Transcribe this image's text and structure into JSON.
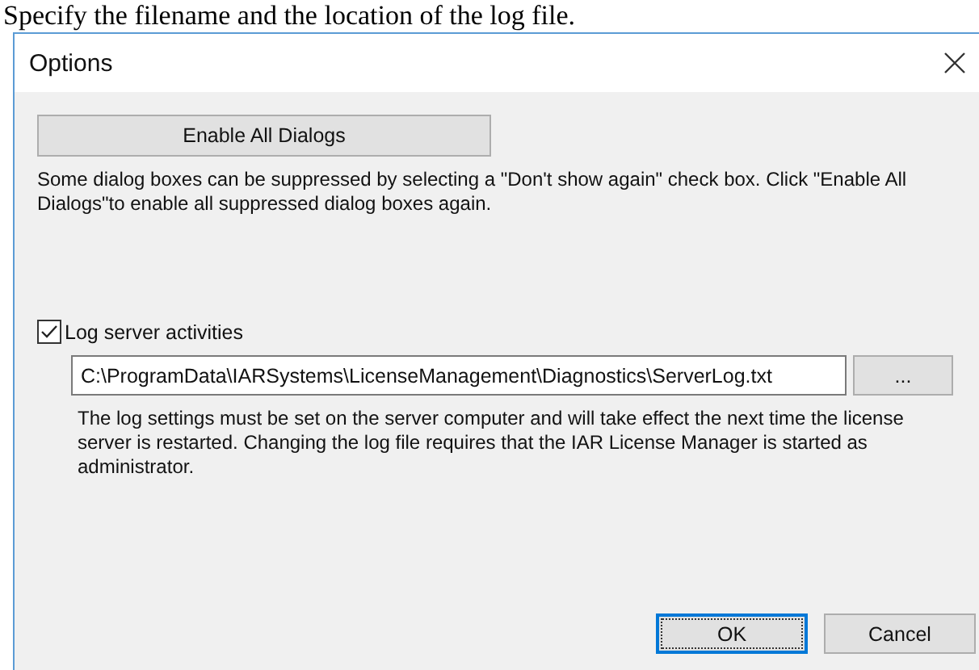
{
  "document_text": "Specify the filename and the location of the log file.",
  "window": {
    "title": "Options"
  },
  "enable_button": "Enable All Dialogs",
  "enable_description": "Some dialog boxes can be suppressed by selecting a \"Don't show again\" check box. Click \"Enable All Dialogs\"to enable all suppressed dialog boxes again.",
  "log_checkbox": {
    "label": "Log server activities",
    "checked": true
  },
  "log_file": {
    "value": "C:\\ProgramData\\IARSystems\\LicenseManagement\\Diagnostics\\ServerLog.txt"
  },
  "browse_button": "...",
  "log_description": "The log settings must be set on the server computer and will take effect the next time the license server is restarted. Changing the log file requires that the IAR License Manager is started as administrator.",
  "buttons": [
    {
      "label": "OK",
      "selected": true
    },
    {
      "label": "Cancel",
      "selected": false
    }
  ]
}
